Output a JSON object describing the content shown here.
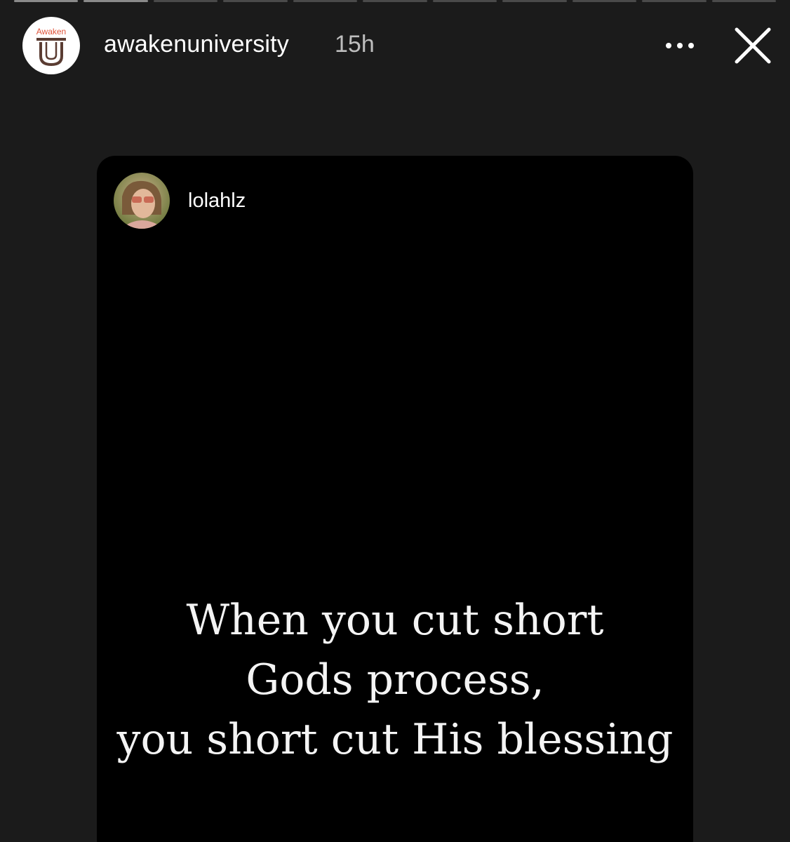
{
  "story": {
    "account": {
      "username": "awakenuniversity",
      "timestamp": "15h",
      "avatar_text": "Awaken",
      "avatar_letter": "U"
    },
    "controls": {
      "more_icon": "more-horizontal-icon",
      "close_icon": "close-icon"
    },
    "progress_segments": 11
  },
  "shared_post": {
    "author": "lolahlz",
    "quote_lines": [
      "When you cut short",
      "Gods process,",
      "you short cut His blessing"
    ]
  },
  "colors": {
    "background": "#1b1b1b",
    "card": "#000000",
    "text": "#ffffff",
    "muted": "#bdbdbd",
    "logo_accent": "#e0533a",
    "logo_dark": "#5a3c32"
  }
}
